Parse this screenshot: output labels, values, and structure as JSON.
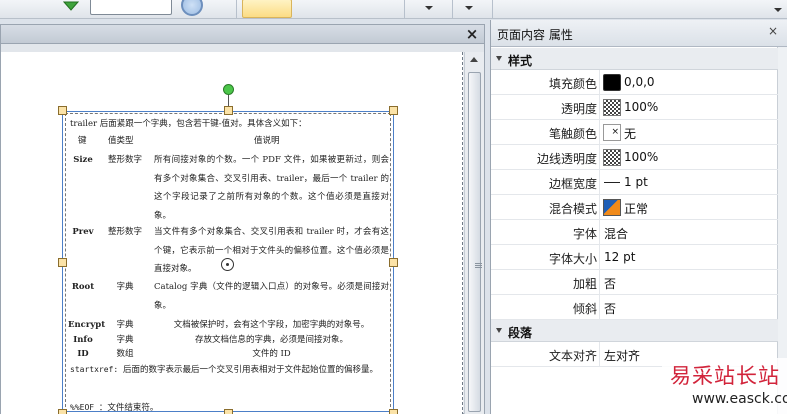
{
  "properties_panel": {
    "title": "页面内容 属性",
    "close": "×",
    "sections": {
      "style": "样式",
      "paragraph": "段落"
    },
    "rows": {
      "fill_color": {
        "label": "填充颜色",
        "value": "0,0,0",
        "swatch": "#000000"
      },
      "opacity": {
        "label": "透明度",
        "value": "100%"
      },
      "stroke_color": {
        "label": "笔触颜色",
        "value": "无",
        "mark": "×"
      },
      "stroke_opacity": {
        "label": "边线透明度",
        "value": "100%"
      },
      "border_width": {
        "label": "边框宽度",
        "value": "1 pt"
      },
      "blend_mode": {
        "label": "混合模式",
        "value": "正常"
      },
      "font": {
        "label": "字体",
        "value": "混合"
      },
      "font_size": {
        "label": "字体大小",
        "value": "12 pt"
      },
      "bold": {
        "label": "加粗",
        "value": "否"
      },
      "italic": {
        "label": "倾斜",
        "value": "否"
      },
      "text_align": {
        "label": "文本对齐",
        "value": "左对齐"
      }
    }
  },
  "document": {
    "close": "×",
    "intro": "trailer 后面紧跟一个字典，包含若干键-值对。具体含义如下：",
    "headers": {
      "key": "键",
      "type": "值类型",
      "desc": "值说明"
    },
    "rows": [
      {
        "key": "Size",
        "type": "整形数字",
        "desc": "所有间接对象的个数。一个 PDF 文件，如果被更新过，则会有多个对象集合、交叉引用表、trailer，最后一个 trailer 的这个字段记录了之前所有对象的个数。这个值必须是直接对象。"
      },
      {
        "key": "Prev",
        "type": "整形数字",
        "desc": "当文件有多个对象集合、交叉引用表和 trailer 时，才会有这个键，它表示前一个相对于文件头的偏移位置。这个值必须是直接对象。"
      },
      {
        "key": "Root",
        "type": "字典",
        "desc": "Catalog 字典（文件的逻辑入口点）的对象号。必须是间接对象。"
      },
      {
        "key": "Encrypt",
        "type": "字典",
        "desc": "文档被保护时，会有这个字段，加密字典的对象号。"
      },
      {
        "key": "Info",
        "type": "字典",
        "desc": "存放文档信息的字典，必须是间接对象。"
      },
      {
        "key": "ID",
        "type": "数组",
        "desc": "文件的 ID"
      }
    ],
    "startxref_label": "startxref:",
    "startxref_text": "后面的数字表示最后一个交叉引用表相对于文件起始位置的偏移量。",
    "eof_label": "%%EOF",
    "eof_text": "：文件结束符。"
  },
  "watermark": {
    "brand": "易采站长站",
    "url": "www.easck.com"
  },
  "colors": {
    "selection": "#4c7fc7",
    "handle_fill": "#fbe3a8",
    "rotate_handle": "#4cc64a",
    "watermark_red": "#d2243b"
  },
  "icons": {
    "toolbar_arrow": "green-arrow-icon",
    "zoom": "zoom-icon",
    "close": "close-icon"
  }
}
